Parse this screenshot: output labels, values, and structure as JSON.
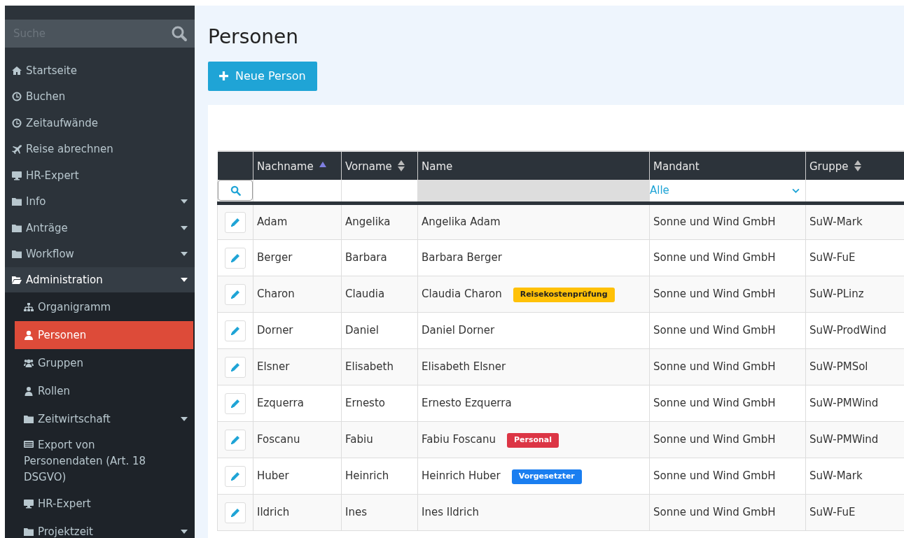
{
  "sidebar": {
    "search": {
      "placeholder": "Suche"
    },
    "items": [
      {
        "label": "Startseite",
        "caret": false,
        "expanded": false,
        "selected": false
      },
      {
        "label": "Buchen",
        "caret": false,
        "expanded": false,
        "selected": false
      },
      {
        "label": "Zeitaufwände",
        "caret": false,
        "expanded": false,
        "selected": false
      },
      {
        "label": "Reise abrechnen",
        "caret": false,
        "expanded": false,
        "selected": false
      },
      {
        "label": "HR-Expert",
        "caret": false,
        "expanded": false,
        "selected": false
      },
      {
        "label": "Info",
        "caret": true,
        "expanded": false,
        "selected": false
      },
      {
        "label": "Anträge",
        "caret": true,
        "expanded": false,
        "selected": false
      },
      {
        "label": "Workflow",
        "caret": true,
        "expanded": false,
        "selected": false
      },
      {
        "label": "Administration",
        "caret": true,
        "expanded": true,
        "selected": false,
        "children": [
          {
            "label": "Organigramm",
            "caret": false,
            "selected": false
          },
          {
            "label": "Personen",
            "caret": false,
            "selected": true
          },
          {
            "label": "Gruppen",
            "caret": false,
            "selected": false
          },
          {
            "label": "Rollen",
            "caret": false,
            "selected": false
          },
          {
            "label": "Zeitwirtschaft",
            "caret": true,
            "selected": false
          },
          {
            "label": "Export von Personendaten (Art. 18 DSGVO)",
            "caret": false,
            "selected": false
          },
          {
            "label": "HR-Expert",
            "caret": false,
            "selected": false
          },
          {
            "label": "Projektzeit",
            "caret": true,
            "selected": false
          }
        ]
      }
    ]
  },
  "page": {
    "title": "Personen",
    "new_button": {
      "label": "Neue Person"
    }
  },
  "table": {
    "columns": [
      {
        "label": "Nachname",
        "kind": "ascending"
      },
      {
        "label": "Vorname",
        "kind": "sortable"
      },
      {
        "label": "Name",
        "kind": "plain"
      },
      {
        "label": "Mandant",
        "kind": "plain"
      },
      {
        "label": "Gruppe",
        "kind": "sortable"
      }
    ],
    "filters": [
      {
        "kind": "text"
      },
      {
        "kind": "text"
      },
      {
        "kind": "disabled"
      },
      {
        "kind": "select",
        "value": "Alle"
      },
      {
        "kind": "text"
      }
    ],
    "rows": [
      {
        "nachname": "Adam",
        "vorname": "Angelika",
        "name": "Angelika Adam",
        "mandant": "Sonne und Wind GmbH",
        "gruppe": "SuW-Mark"
      },
      {
        "nachname": "Berger",
        "vorname": "Barbara",
        "name": "Barbara Berger",
        "mandant": "Sonne und Wind GmbH",
        "gruppe": "SuW-FuE"
      },
      {
        "nachname": "Charon",
        "vorname": "Claudia",
        "name": "Claudia Charon",
        "tag": {
          "label": "Reisekostenprüfung",
          "color": "#ffc107"
        },
        "mandant": "Sonne und Wind GmbH",
        "gruppe": "SuW-PLinz"
      },
      {
        "nachname": "Dorner",
        "vorname": "Daniel",
        "name": "Daniel Dorner",
        "mandant": "Sonne und Wind GmbH",
        "gruppe": "SuW-ProdWind"
      },
      {
        "nachname": "Elsner",
        "vorname": "Elisabeth",
        "name": "Elisabeth Elsner",
        "mandant": "Sonne und Wind GmbH",
        "gruppe": "SuW-PMSol"
      },
      {
        "nachname": "Ezquerra",
        "vorname": "Ernesto",
        "name": "Ernesto Ezquerra",
        "mandant": "Sonne und Wind GmbH",
        "gruppe": "SuW-PMWind"
      },
      {
        "nachname": "Foscanu",
        "vorname": "Fabiu",
        "name": "Fabiu Foscanu",
        "tag": {
          "label": "Personal",
          "color": "#dc3545"
        },
        "mandant": "Sonne und Wind GmbH",
        "gruppe": "SuW-PMWind"
      },
      {
        "nachname": "Huber",
        "vorname": "Heinrich",
        "name": "Heinrich Huber",
        "tag": {
          "label": "Vorgesetzter",
          "color": "#1a7ef0"
        },
        "mandant": "Sonne und Wind GmbH",
        "gruppe": "SuW-Mark"
      },
      {
        "nachname": "Ildrich",
        "vorname": "Ines",
        "name": "Ines Ildrich",
        "mandant": "Sonne und Wind GmbH",
        "gruppe": "SuW-FuE"
      }
    ]
  }
}
